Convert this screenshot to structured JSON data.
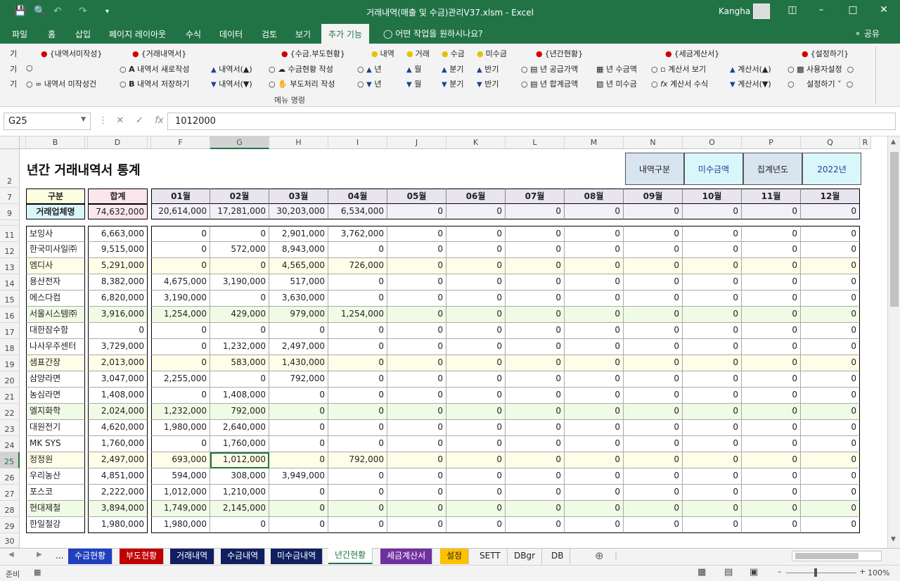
{
  "window": {
    "title": "거래내역(매출 및 수금)관리V37.xlsm - Excel",
    "user": "Kangha"
  },
  "ribbon_tabs": [
    "파일",
    "홈",
    "삽입",
    "페이지 레이아웃",
    "수식",
    "데이터",
    "검토",
    "보기",
    "추가 기능"
  ],
  "active_tab": "추가 기능",
  "tell_me": "어떤 작업을 원하시나요?",
  "share": "공유",
  "ribbon": {
    "edge_labels": [
      "기",
      "기",
      "기"
    ],
    "col1": {
      "header": "{내역서미작성}",
      "r3": "내역서 미작성건"
    },
    "col2": {
      "header": "{거래내역서}",
      "r2": "내역서 새로작성",
      "r3": "내역서 저장하기",
      "r2b": "내역서(▲)",
      "r3b": "내역서(▼)"
    },
    "col3": {
      "header": "{수금.부도현황}",
      "r2": "수금현황 작성",
      "r3": "부도처리 작성"
    },
    "col4": {
      "h1": "내역",
      "h2": "거래",
      "h3": "수금",
      "h4": "미수금",
      "r2": [
        "년",
        "월",
        "분기",
        "반기"
      ],
      "r3": [
        "년",
        "월",
        "분기",
        "반기"
      ]
    },
    "col5": {
      "header": "{년간현황}",
      "r2": "년 공급가액",
      "r3": "년 합계금액",
      "r2b": "년 수금액",
      "r3b": "년 미수금"
    },
    "col6": {
      "header": "{세금계산서}",
      "r2": "계산서 보기",
      "r3": "계산서 수식",
      "r2b": "계산서(▲)",
      "r3b": "계산서(▼)"
    },
    "col7": {
      "header": "{설정하기}",
      "r2": "사용자설정",
      "r3": "설정하기"
    },
    "group_label": "메뉴 명령"
  },
  "formula_bar": {
    "name_box": "G25",
    "value": "1012000"
  },
  "columns": [
    "A",
    "B",
    "C",
    "D",
    "E",
    "F",
    "G",
    "H",
    "I",
    "J",
    "K",
    "L",
    "M",
    "N",
    "O",
    "P",
    "Q",
    "R"
  ],
  "selected_column": "G",
  "rows": [
    "2",
    "7",
    "9",
    "10",
    "11",
    "12",
    "13",
    "14",
    "15",
    "16",
    "17",
    "18",
    "19",
    "20",
    "21",
    "22",
    "23",
    "24",
    "25",
    "26",
    "27",
    "28",
    "29",
    "30"
  ],
  "selected_row": "25",
  "sheet_title": "년간 거래내역서 통계",
  "summary": {
    "label1": "내역구분",
    "value1": "미수금액",
    "label2": "집계년도",
    "value2": "2022년"
  },
  "table": {
    "h_gubun": "구분",
    "h_total": "합계",
    "months": [
      "01월",
      "02월",
      "03월",
      "04월",
      "05월",
      "06월",
      "07월",
      "08월",
      "09월",
      "10월",
      "11월",
      "12월"
    ],
    "r9_label": "거래업체명",
    "r9_total": "74,632,000",
    "r9_months": [
      "20,614,000",
      "17,281,000",
      "30,203,000",
      "6,534,000",
      "0",
      "0",
      "0",
      "0",
      "0",
      "0",
      "0",
      "0"
    ],
    "data": [
      {
        "name": "보잉사",
        "total": "6,663,000",
        "m": [
          "0",
          "0",
          "2,901,000",
          "3,762,000",
          "0",
          "0",
          "0",
          "0",
          "0",
          "0",
          "0",
          "0"
        ]
      },
      {
        "name": "한국미사일㈜",
        "total": "9,515,000",
        "m": [
          "0",
          "572,000",
          "8,943,000",
          "0",
          "0",
          "0",
          "0",
          "0",
          "0",
          "0",
          "0",
          "0"
        ]
      },
      {
        "name": "엠디사",
        "total": "5,291,000",
        "m": [
          "0",
          "0",
          "4,565,000",
          "726,000",
          "0",
          "0",
          "0",
          "0",
          "0",
          "0",
          "0",
          "0"
        ]
      },
      {
        "name": "용산전자",
        "total": "8,382,000",
        "m": [
          "4,675,000",
          "3,190,000",
          "517,000",
          "0",
          "0",
          "0",
          "0",
          "0",
          "0",
          "0",
          "0",
          "0"
        ]
      },
      {
        "name": "에스다컴",
        "total": "6,820,000",
        "m": [
          "3,190,000",
          "0",
          "3,630,000",
          "0",
          "0",
          "0",
          "0",
          "0",
          "0",
          "0",
          "0",
          "0"
        ]
      },
      {
        "name": "서울시스템㈜",
        "total": "3,916,000",
        "m": [
          "1,254,000",
          "429,000",
          "979,000",
          "1,254,000",
          "0",
          "0",
          "0",
          "0",
          "0",
          "0",
          "0",
          "0"
        ]
      },
      {
        "name": "대한잠수함",
        "total": "0",
        "m": [
          "0",
          "0",
          "0",
          "0",
          "0",
          "0",
          "0",
          "0",
          "0",
          "0",
          "0",
          "0"
        ]
      },
      {
        "name": "나사우주센터",
        "total": "3,729,000",
        "m": [
          "0",
          "1,232,000",
          "2,497,000",
          "0",
          "0",
          "0",
          "0",
          "0",
          "0",
          "0",
          "0",
          "0"
        ]
      },
      {
        "name": "샘표간장",
        "total": "2,013,000",
        "m": [
          "0",
          "583,000",
          "1,430,000",
          "0",
          "0",
          "0",
          "0",
          "0",
          "0",
          "0",
          "0",
          "0"
        ]
      },
      {
        "name": "삼양라면",
        "total": "3,047,000",
        "m": [
          "2,255,000",
          "0",
          "792,000",
          "0",
          "0",
          "0",
          "0",
          "0",
          "0",
          "0",
          "0",
          "0"
        ]
      },
      {
        "name": "농심라면",
        "total": "1,408,000",
        "m": [
          "0",
          "1,408,000",
          "0",
          "0",
          "0",
          "0",
          "0",
          "0",
          "0",
          "0",
          "0",
          "0"
        ]
      },
      {
        "name": "엘지화학",
        "total": "2,024,000",
        "m": [
          "1,232,000",
          "792,000",
          "0",
          "0",
          "0",
          "0",
          "0",
          "0",
          "0",
          "0",
          "0",
          "0"
        ]
      },
      {
        "name": "대원전기",
        "total": "4,620,000",
        "m": [
          "1,980,000",
          "2,640,000",
          "0",
          "0",
          "0",
          "0",
          "0",
          "0",
          "0",
          "0",
          "0",
          "0"
        ]
      },
      {
        "name": "MK SYS",
        "total": "1,760,000",
        "m": [
          "0",
          "1,760,000",
          "0",
          "0",
          "0",
          "0",
          "0",
          "0",
          "0",
          "0",
          "0",
          "0"
        ]
      },
      {
        "name": "정정원",
        "total": "2,497,000",
        "m": [
          "693,000",
          "1,012,000",
          "0",
          "792,000",
          "0",
          "0",
          "0",
          "0",
          "0",
          "0",
          "0",
          "0"
        ]
      },
      {
        "name": "우리농산",
        "total": "4,851,000",
        "m": [
          "594,000",
          "308,000",
          "3,949,000",
          "0",
          "0",
          "0",
          "0",
          "0",
          "0",
          "0",
          "0",
          "0"
        ]
      },
      {
        "name": "포스코",
        "total": "2,222,000",
        "m": [
          "1,012,000",
          "1,210,000",
          "0",
          "0",
          "0",
          "0",
          "0",
          "0",
          "0",
          "0",
          "0",
          "0"
        ]
      },
      {
        "name": "현대제철",
        "total": "3,894,000",
        "m": [
          "1,749,000",
          "2,145,000",
          "0",
          "0",
          "0",
          "0",
          "0",
          "0",
          "0",
          "0",
          "0",
          "0"
        ]
      },
      {
        "name": "한일철강",
        "total": "1,980,000",
        "m": [
          "1,980,000",
          "0",
          "0",
          "0",
          "0",
          "0",
          "0",
          "0",
          "0",
          "0",
          "0",
          "0"
        ]
      }
    ]
  },
  "sheet_tabs": [
    {
      "label": "...",
      "bg": "#f3f3f3",
      "fg": "#222"
    },
    {
      "label": "수금현황",
      "bg": "#1f3fbf",
      "fg": "#ffffff"
    },
    {
      "label": "부도현황",
      "bg": "#c00000",
      "fg": "#ffffff"
    },
    {
      "label": "거래내역",
      "bg": "#0f1f5f",
      "fg": "#ffffff"
    },
    {
      "label": "수금내역",
      "bg": "#0f1f5f",
      "fg": "#ffffff"
    },
    {
      "label": "미수금내역",
      "bg": "#0f1f5f",
      "fg": "#ffffff"
    },
    {
      "label": "년간현황",
      "bg": "#ffffff",
      "fg": "#217346"
    },
    {
      "label": "세금계산서",
      "bg": "#7030a0",
      "fg": "#ffffff"
    },
    {
      "label": "설정",
      "bg": "#ffc000",
      "fg": "#222222"
    },
    {
      "label": "SETT",
      "bg": "#f3f3f3",
      "fg": "#222222"
    },
    {
      "label": "DBgr",
      "bg": "#f3f3f3",
      "fg": "#222222"
    },
    {
      "label": "DB",
      "bg": "#f3f3f3",
      "fg": "#222222"
    }
  ],
  "status": {
    "ready": "준비",
    "zoom": "100%"
  },
  "colors": {
    "excel_green": "#217346",
    "yellow_row": "#fefee8",
    "green_row": "#f0fbe6",
    "total_pink": "#fbe6ec",
    "month_header": "#e8e4f0"
  }
}
